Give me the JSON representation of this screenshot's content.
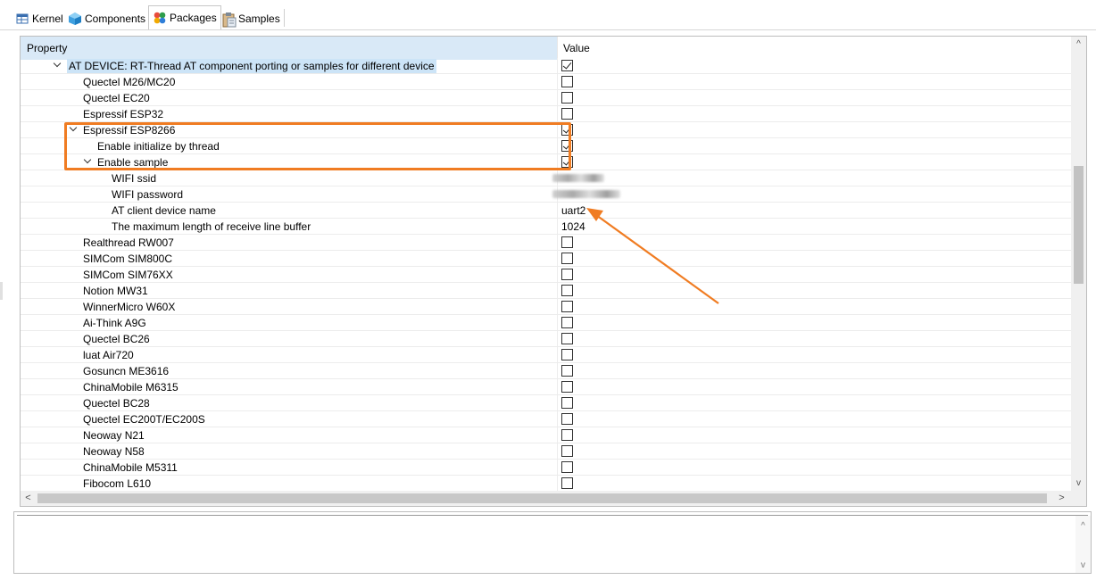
{
  "tabs": [
    {
      "label": "Kernel",
      "icon": "table-icon",
      "active": false
    },
    {
      "label": "Components",
      "icon": "cube-icon",
      "active": false
    },
    {
      "label": "Packages",
      "icon": "packages-icon",
      "active": true
    },
    {
      "label": "Samples",
      "icon": "clipboard-icon",
      "active": false
    }
  ],
  "table": {
    "header": {
      "property": "Property",
      "value": "Value"
    },
    "rows": [
      {
        "label": "AT DEVICE: RT-Thread AT component porting or samples for different device",
        "indent": 1,
        "expanded": true,
        "checked": true,
        "value_type": "checkbox",
        "selected": true
      },
      {
        "label": "Quectel M26/MC20",
        "indent": 2,
        "checked": false,
        "value_type": "checkbox"
      },
      {
        "label": "Quectel EC20",
        "indent": 2,
        "checked": false,
        "value_type": "checkbox"
      },
      {
        "label": "Espressif ESP32",
        "indent": 2,
        "checked": false,
        "value_type": "checkbox"
      },
      {
        "label": "Espressif ESP8266",
        "indent": 2,
        "expanded": true,
        "checked": true,
        "value_type": "checkbox"
      },
      {
        "label": "Enable initialize by thread",
        "indent": 3,
        "checked": true,
        "value_type": "checkbox"
      },
      {
        "label": "Enable sample",
        "indent": 3,
        "expanded": true,
        "checked": true,
        "value_type": "checkbox"
      },
      {
        "label": "WIFI ssid",
        "indent": 4,
        "value_type": "redacted"
      },
      {
        "label": "WIFI password",
        "indent": 4,
        "value_type": "redacted"
      },
      {
        "label": "AT client device name",
        "indent": 4,
        "value": "uart2",
        "value_type": "text"
      },
      {
        "label": "The maximum length of receive line buffer",
        "indent": 4,
        "value": "1024",
        "value_type": "text"
      },
      {
        "label": "Realthread RW007",
        "indent": 2,
        "checked": false,
        "value_type": "checkbox"
      },
      {
        "label": "SIMCom SIM800C",
        "indent": 2,
        "checked": false,
        "value_type": "checkbox"
      },
      {
        "label": "SIMCom SIM76XX",
        "indent": 2,
        "checked": false,
        "value_type": "checkbox"
      },
      {
        "label": "Notion MW31",
        "indent": 2,
        "checked": false,
        "value_type": "checkbox"
      },
      {
        "label": "WinnerMicro W60X",
        "indent": 2,
        "checked": false,
        "value_type": "checkbox"
      },
      {
        "label": "Ai-Think A9G",
        "indent": 2,
        "checked": false,
        "value_type": "checkbox"
      },
      {
        "label": "Quectel BC26",
        "indent": 2,
        "checked": false,
        "value_type": "checkbox"
      },
      {
        "label": "luat Air720",
        "indent": 2,
        "checked": false,
        "value_type": "checkbox"
      },
      {
        "label": "Gosuncn ME3616",
        "indent": 2,
        "checked": false,
        "value_type": "checkbox"
      },
      {
        "label": "ChinaMobile M6315",
        "indent": 2,
        "checked": false,
        "value_type": "checkbox"
      },
      {
        "label": "Quectel BC28",
        "indent": 2,
        "checked": false,
        "value_type": "checkbox"
      },
      {
        "label": "Quectel EC200T/EC200S",
        "indent": 2,
        "checked": false,
        "value_type": "checkbox"
      },
      {
        "label": "Neoway N21",
        "indent": 2,
        "checked": false,
        "value_type": "checkbox"
      },
      {
        "label": "Neoway N58",
        "indent": 2,
        "checked": false,
        "value_type": "checkbox"
      },
      {
        "label": "ChinaMobile M5311",
        "indent": 2,
        "checked": false,
        "value_type": "checkbox"
      },
      {
        "label": "Fibocom L610",
        "indent": 2,
        "checked": false,
        "value_type": "checkbox"
      }
    ]
  },
  "annotation": {
    "color": "#f07c22"
  },
  "colors": {
    "selection": "#cce4f7",
    "header_property_bg": "#d9e9f7"
  }
}
